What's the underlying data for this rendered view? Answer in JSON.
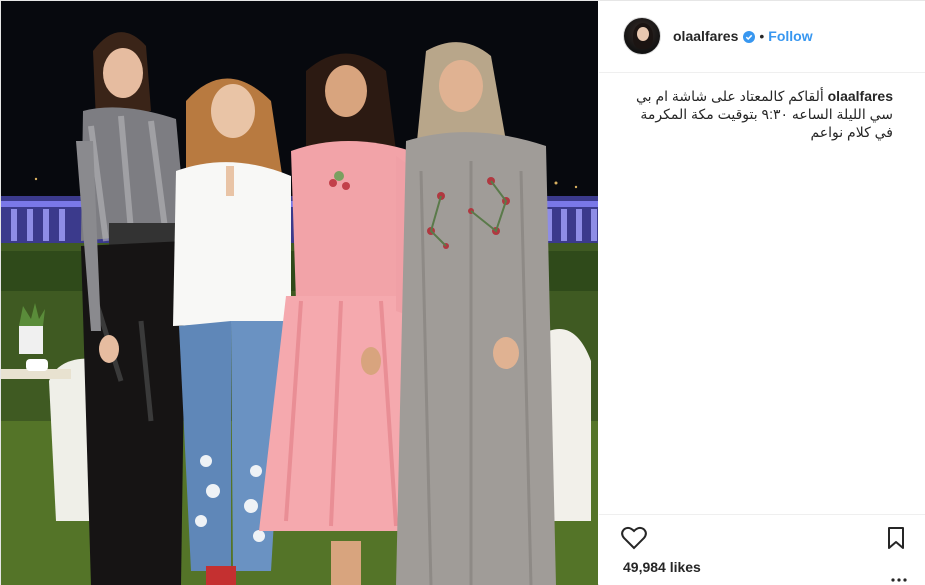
{
  "post": {
    "username": "olaalfares",
    "follow_label": "Follow",
    "separator": "•",
    "caption_text": "ألقاكم كالمعتاد على شاشة ام بي سي الليلة الساعه ٩:٣٠ بتوقيت مكة المكرمة في كلام نواعم",
    "likes_text": "49,984 likes"
  },
  "icons": {
    "verified": "verified-badge-icon",
    "like": "heart-icon",
    "save": "bookmark-icon",
    "more": "more-options-icon"
  },
  "colors": {
    "accent": "#3897f0",
    "text": "#262626",
    "border": "#efefef"
  }
}
